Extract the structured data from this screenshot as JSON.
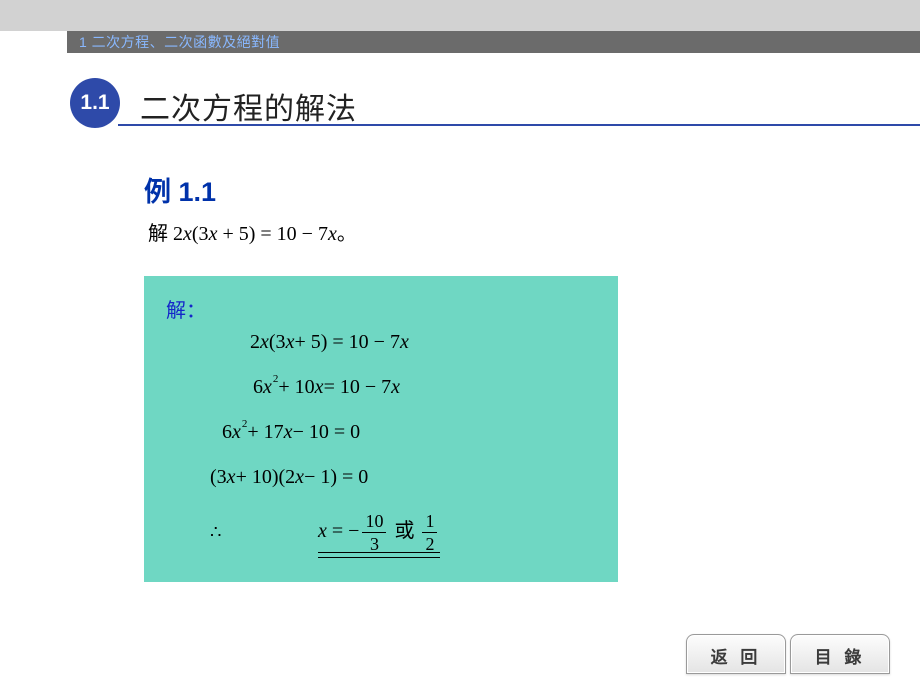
{
  "chapter": {
    "label": "1 二次方程、二次函數及絕對值"
  },
  "section": {
    "number": "1.1",
    "title": "二次方程的解法"
  },
  "example": {
    "label": "例 1.1",
    "prompt_prefix_cjk": "解 ",
    "prompt_math_html": "2<span class=\"mi\">x</span>(3<span class=\"mi\">x</span> + 5) = 10 &minus; 7<span class=\"mi\">x</span>",
    "prompt_suffix_cjk": "。"
  },
  "solution": {
    "label": "解：",
    "steps": [
      "2<span class=\"mi\">x</span>(3<span class=\"mi\">x</span> + 5) = 10 &minus; 7<span class=\"mi\">x</span>",
      "6<span class=\"mi\">x</span><span class=\"sup\">2</span> + 10<span class=\"mi\">x</span> = 10 &minus; 7<span class=\"mi\">x</span>",
      "6<span class=\"mi\">x</span><span class=\"sup\">2</span> + 17<span class=\"mi\">x</span> &minus; 10 = 0",
      "(3<span class=\"mi\">x</span> + 10)(2<span class=\"mi\">x</span> &minus; 1) = 0"
    ],
    "final_prefix_symbol": "∴",
    "final_html": "<span class=\"mi\">x</span> = &minus;<span class=\"frac\"><span class=\"num\">10</span><span class=\"bar\"></span><span class=\"den\">3</span></span>&nbsp;<span style=\"font-family:PMingLiU,SimSun,serif;font-style:normal\">或</span>&nbsp;<span class=\"frac\"><span class=\"num\">1</span><span class=\"bar\"></span><span class=\"den\">2</span></span>"
  },
  "buttons": {
    "back": "返 回",
    "toc": "目 錄"
  }
}
